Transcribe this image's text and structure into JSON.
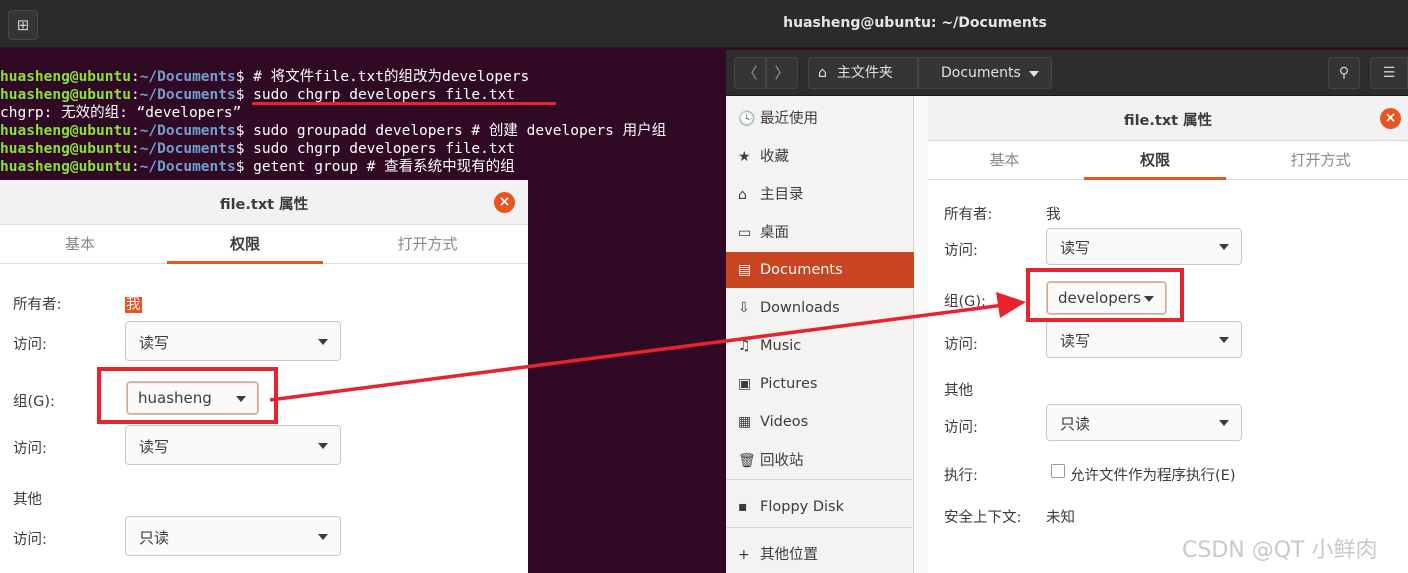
{
  "terminal": {
    "title": "huasheng@ubuntu: ~/Documents",
    "new_tab_icon": "new-tab-icon",
    "prompt_user": "huasheng@ubuntu",
    "prompt_sep": ":",
    "prompt_path": "~/Documents",
    "prompt_dollar": "$",
    "lines": [
      {
        "type": "prompt",
        "cmd": " # 将文件file.txt的组改为developers"
      },
      {
        "type": "prompt",
        "cmd": " sudo chgrp developers file.txt"
      },
      {
        "type": "output",
        "text": "chgrp: 无效的组: “developers”"
      },
      {
        "type": "prompt",
        "cmd": " sudo groupadd developers # 创建 developers 用户组"
      },
      {
        "type": "prompt",
        "cmd": " sudo chgrp developers file.txt"
      },
      {
        "type": "prompt",
        "cmd": " getent group # 查看系统中现有的组"
      }
    ]
  },
  "left_dialog": {
    "title": "file.txt 属性",
    "close_icon": "close-icon",
    "tabs": [
      "基本",
      "权限",
      "打开方式"
    ],
    "active_tab": "权限",
    "owner_label": "所有者:",
    "owner_value": "我",
    "owner_access_label": "访问:",
    "owner_access_value": "读写",
    "group_label": "组(G):",
    "group_value": "huasheng",
    "group_access_label": "访问:",
    "group_access_value": "读写",
    "others_section": "其他",
    "others_access_label": "访问:",
    "others_access_value": "只读"
  },
  "files_window": {
    "back_icon": "chevron-left-icon",
    "forward_icon": "chevron-right-icon",
    "home_icon": "home-icon",
    "home_crumb": "主文件夹",
    "current_crumb": "Documents",
    "search_icon": "search-icon",
    "list_view_icon": "list-view-icon",
    "sidebar": [
      {
        "label": "最近使用",
        "icon": "clock-icon",
        "glyph": "🕓"
      },
      {
        "label": "收藏",
        "icon": "star-icon",
        "glyph": "★"
      },
      {
        "label": "主目录",
        "icon": "home-icon",
        "glyph": "⌂"
      },
      {
        "label": "桌面",
        "icon": "desktop-icon",
        "glyph": "▭"
      },
      {
        "label": "Documents",
        "icon": "document-icon",
        "glyph": "▤",
        "active": true
      },
      {
        "label": "Downloads",
        "icon": "download-icon",
        "glyph": "⇩"
      },
      {
        "label": "Music",
        "icon": "music-icon",
        "glyph": "♫"
      },
      {
        "label": "Pictures",
        "icon": "picture-icon",
        "glyph": "▣"
      },
      {
        "label": "Videos",
        "icon": "video-icon",
        "glyph": "▦"
      },
      {
        "label": "回收站",
        "icon": "trash-icon",
        "glyph": "🗑"
      },
      {
        "label": "Floppy Disk",
        "icon": "floppy-icon",
        "glyph": "▪"
      },
      {
        "label": "其他位置",
        "icon": "plus-icon",
        "glyph": "+"
      }
    ]
  },
  "right_dialog": {
    "title": "file.txt 属性",
    "close_icon": "close-icon",
    "tabs": [
      "基本",
      "权限",
      "打开方式"
    ],
    "active_tab": "权限",
    "owner_label": "所有者:",
    "owner_value": "我",
    "owner_access_label": "访问:",
    "owner_access_value": "读写",
    "group_label": "组(G):",
    "group_value": "developers",
    "group_access_label": "访问:",
    "group_access_value": "读写",
    "others_section": "其他",
    "others_access_label": "访问:",
    "others_access_value": "只读",
    "execute_label": "执行:",
    "execute_checkbox_label": "允许文件作为程序执行(E)",
    "execute_checked": false,
    "security_label": "安全上下文:",
    "security_value": "未知"
  },
  "annotations": {
    "highlight_color": "#e8232d",
    "accent_color": "#e95420"
  },
  "watermark": "CSDN @QT 小鲜肉"
}
